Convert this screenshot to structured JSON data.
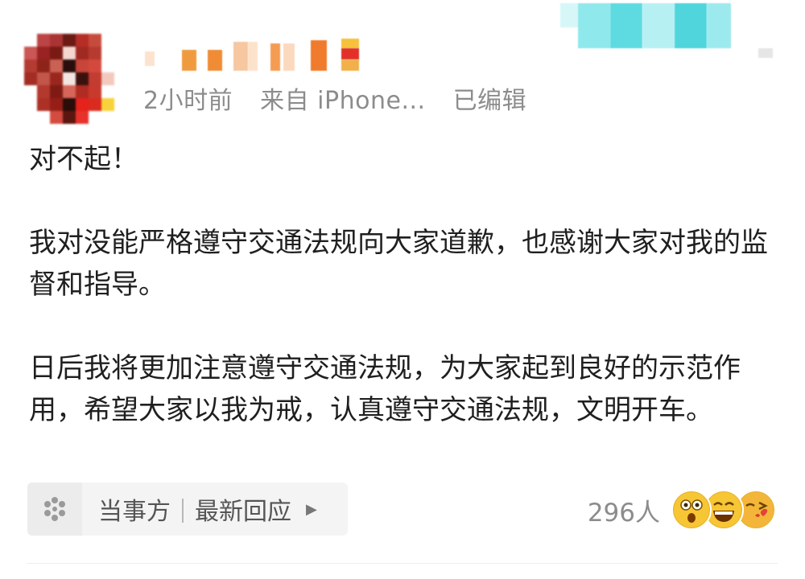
{
  "post": {
    "meta": {
      "time": "2小时前",
      "source": "来自 iPhone...",
      "edited": "已编辑"
    },
    "paragraphs": [
      "对不起！",
      "我对没能严格遵守交通法规向大家道歉，也感谢大家对我的监督和指导。",
      "日后我将更加注意遵守交通法规，为大家起到良好的示范作用，希望大家以我为戒，认真遵守交通法规，文明开车。"
    ]
  },
  "topic_chip": {
    "icon": "pinwheel-icon",
    "label_primary": "当事方",
    "label_secondary": "最新回应",
    "arrow_icon": "chevron-right-icon"
  },
  "reactions": {
    "count": "296人",
    "icons": [
      "shocked-face-icon",
      "laughing-face-icon",
      "kiss-face-icon"
    ]
  },
  "colors": {
    "meta_text": "#8c8c8c",
    "body_text": "#1f1f1f",
    "chip_bg": "#f4f4f4",
    "emoji_yellow": "#f7c635"
  }
}
